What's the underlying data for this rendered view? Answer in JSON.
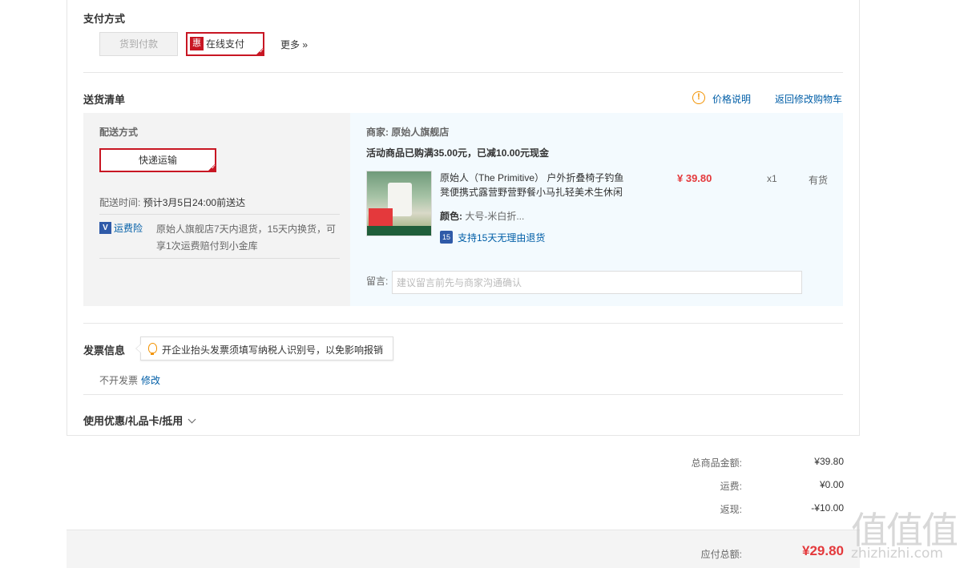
{
  "payment": {
    "title": "支付方式",
    "cod_label": "货到付款",
    "online_badge": "惠",
    "online_label": "在线支付",
    "more_label": "更多 »"
  },
  "shipping_list": {
    "title": "送货清单",
    "price_note_icon": "!",
    "price_note": "价格说明",
    "back_to_cart": "返回修改购物车",
    "delivery": {
      "method_title": "配送方式",
      "method_selected": "快递运输",
      "time_label": "配送时间:",
      "time_value": "预计3月5日24:00前送达",
      "insurance_icon": "V",
      "insurance_link": "运费险",
      "insurance_text": "原始人旗舰店7天内退货，15天内换货，可享1次运费赔付到小金库"
    },
    "store": {
      "merchant_label": "商家:",
      "merchant_name": "原始人旗舰店",
      "promo": "活动商品已购满35.00元，已减10.00元现金",
      "item": {
        "name": "原始人（The Primitive） 户外折叠椅子钓鱼凳便携式露营野营野餐小马扎轻美术生休闲",
        "price": "¥ 39.80",
        "qty": "x1",
        "stock": "有货",
        "color_label": "颜色:",
        "color_value": "大号-米白折...",
        "return_icon": "15",
        "return_text": "支持15天无理由退货"
      },
      "memo_label": "留言:",
      "memo_placeholder": "建议留言前先与商家沟通确认"
    }
  },
  "invoice": {
    "title": "发票信息",
    "tip": "开企业抬头发票须填写纳税人识别号，以免影响报销",
    "status": "不开发票",
    "edit": "修改"
  },
  "coupon": {
    "label": "使用优惠/礼品卡/抵用"
  },
  "summary": {
    "goods_label": "总商品金额:",
    "goods_value": "¥39.80",
    "shipping_label": "运费:",
    "shipping_value": "¥0.00",
    "rebate_label": "返现:",
    "rebate_value": "-¥10.00",
    "total_label": "应付总额:",
    "total_value": "¥29.80"
  },
  "watermark": {
    "logo": "值值值",
    "text": "zhizhizhi.com"
  }
}
